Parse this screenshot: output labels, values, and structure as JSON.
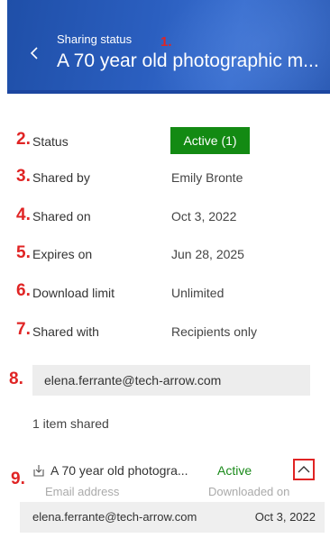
{
  "header": {
    "subtitle": "Sharing status",
    "title": "A 70 year old photographic m...",
    "back_icon": "chevron-left-icon"
  },
  "markers": [
    "1.",
    "2.",
    "3.",
    "4.",
    "5.",
    "6.",
    "7.",
    "8.",
    "9."
  ],
  "details": {
    "status": {
      "label": "Status",
      "value": "Active (1)"
    },
    "shared_by": {
      "label": "Shared by",
      "value": "Emily Bronte"
    },
    "shared_on": {
      "label": "Shared on",
      "value": "Oct 3, 2022"
    },
    "expires_on": {
      "label": "Expires on",
      "value": "Jun 28, 2025"
    },
    "download_limit": {
      "label": "Download limit",
      "value": "Unlimited"
    },
    "shared_with": {
      "label": "Shared with",
      "value": "Recipients only"
    }
  },
  "recipient_email": "elena.ferrante@tech-arrow.com",
  "items_count_text": "1 item shared",
  "items": [
    {
      "icon": "download-icon",
      "name": "A 70 year old photogra...",
      "status": "Active",
      "expand_icon": "chevron-up-icon",
      "columns": {
        "email_header": "Email address",
        "downloaded_header": "Downloaded on"
      },
      "recipients": [
        {
          "email": "elena.ferrante@tech-arrow.com",
          "downloaded_on": "Oct 3, 2022"
        }
      ]
    }
  ],
  "colors": {
    "header_bg": "#2b5fc0",
    "status_badge": "#138a13",
    "active_text": "#1a8a1a",
    "marker": "#e02424"
  }
}
